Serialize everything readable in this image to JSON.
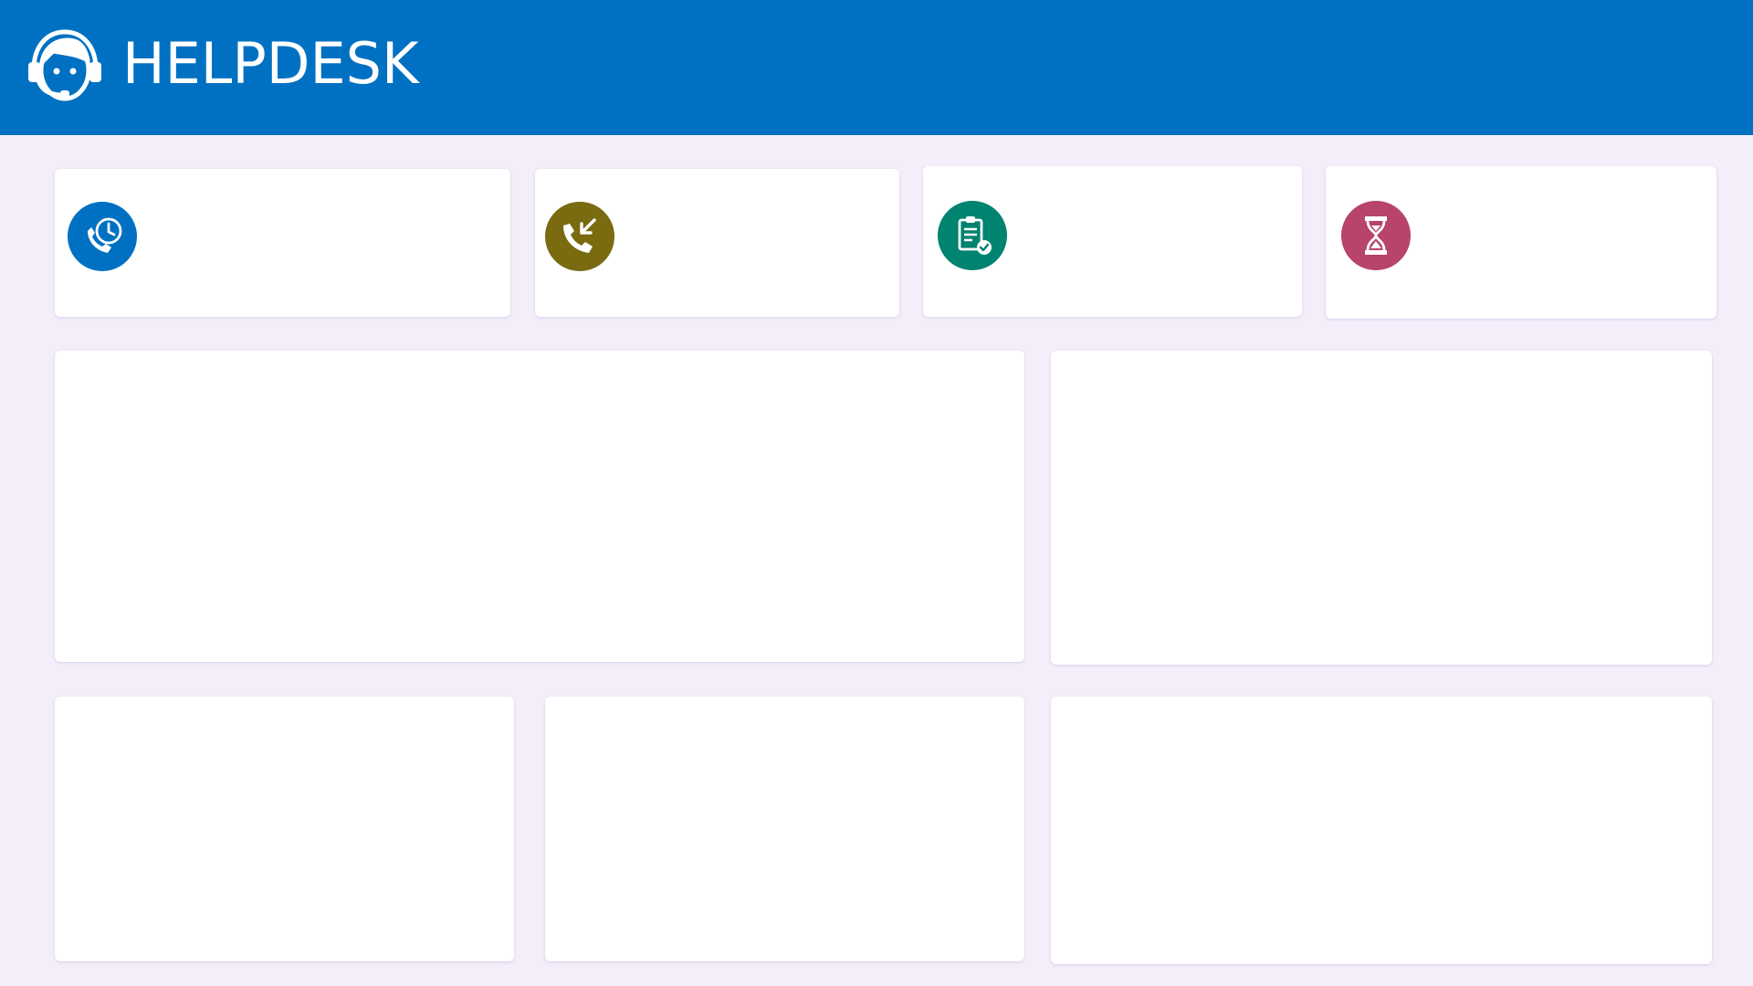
{
  "header": {
    "title": "HELPDESK",
    "logo_icon": "support-agent-headset-icon",
    "background": "#0071c2"
  },
  "kpi_cards": [
    {
      "icon": "call-time-icon",
      "color": "#0071c2"
    },
    {
      "icon": "incoming-call-icon",
      "color": "#7a6a10"
    },
    {
      "icon": "clipboard-check-icon",
      "color": "#00836f"
    },
    {
      "icon": "hourglass-icon",
      "color": "#b8436b"
    }
  ],
  "page_background": "#f4eefb"
}
